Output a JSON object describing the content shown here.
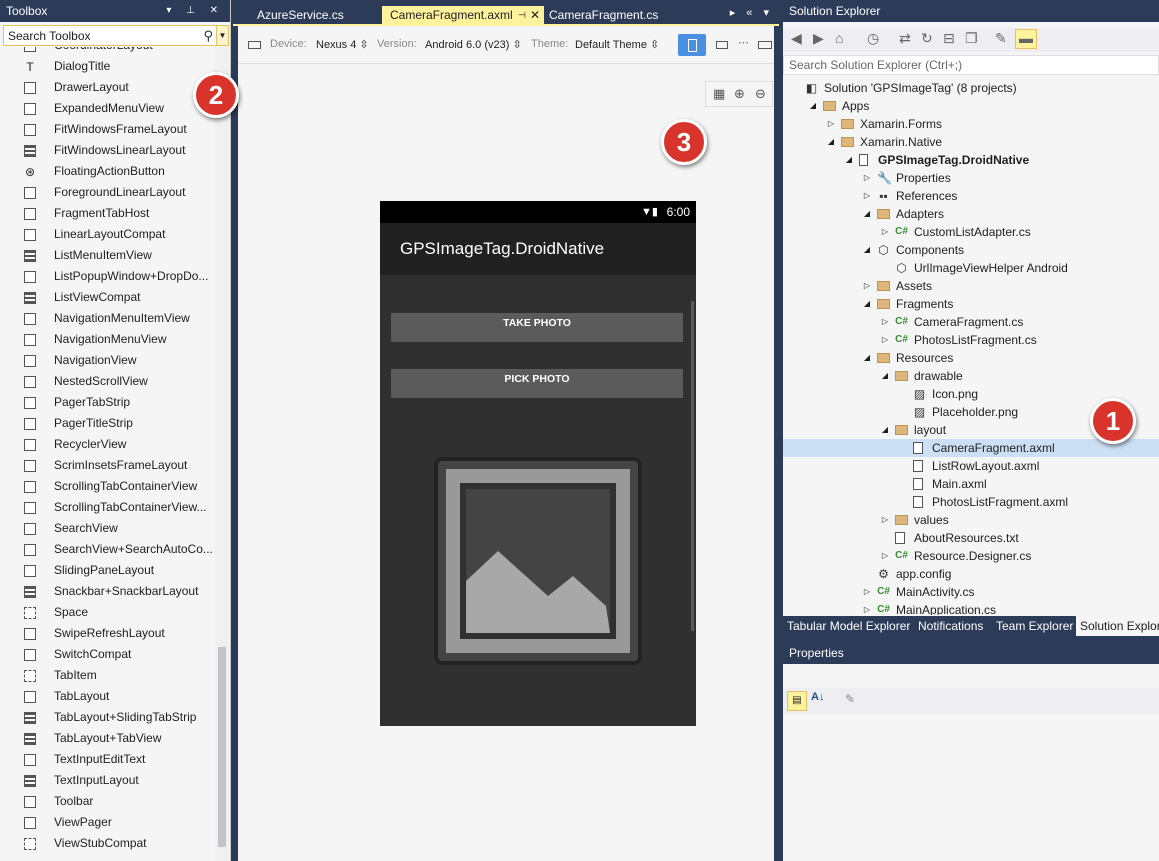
{
  "toolbox": {
    "title": "Toolbox",
    "search_value": "Search Toolbox",
    "items": [
      {
        "label": "CoordinatorLayout",
        "icon": "box-icon"
      },
      {
        "label": "DialogTitle",
        "icon": "text-icon"
      },
      {
        "label": "DrawerLayout",
        "icon": "box-icon"
      },
      {
        "label": "ExpandedMenuView",
        "icon": "box-icon"
      },
      {
        "label": "FitWindowsFrameLayout",
        "icon": "box-icon"
      },
      {
        "label": "FitWindowsLinearLayout",
        "icon": "list-icon"
      },
      {
        "label": "FloatingActionButton",
        "icon": "fab-icon"
      },
      {
        "label": "ForegroundLinearLayout",
        "icon": "box-icon"
      },
      {
        "label": "FragmentTabHost",
        "icon": "box-icon"
      },
      {
        "label": "LinearLayoutCompat",
        "icon": "box-icon"
      },
      {
        "label": "ListMenuItemView",
        "icon": "list-icon"
      },
      {
        "label": "ListPopupWindow+DropDo...",
        "icon": "box-icon"
      },
      {
        "label": "ListViewCompat",
        "icon": "list-icon"
      },
      {
        "label": "NavigationMenuItemView",
        "icon": "box-icon"
      },
      {
        "label": "NavigationMenuView",
        "icon": "box-icon"
      },
      {
        "label": "NavigationView",
        "icon": "box-icon"
      },
      {
        "label": "NestedScrollView",
        "icon": "box-icon"
      },
      {
        "label": "PagerTabStrip",
        "icon": "box-icon"
      },
      {
        "label": "PagerTitleStrip",
        "icon": "box-icon"
      },
      {
        "label": "RecyclerView",
        "icon": "box-icon"
      },
      {
        "label": "ScrimInsetsFrameLayout",
        "icon": "box-icon"
      },
      {
        "label": "ScrollingTabContainerView",
        "icon": "box-icon"
      },
      {
        "label": "ScrollingTabContainerView...",
        "icon": "box-icon"
      },
      {
        "label": "SearchView",
        "icon": "box-icon"
      },
      {
        "label": "SearchView+SearchAutoCo...",
        "icon": "box-icon"
      },
      {
        "label": "SlidingPaneLayout",
        "icon": "box-icon"
      },
      {
        "label": "Snackbar+SnackbarLayout",
        "icon": "list-icon"
      },
      {
        "label": "Space",
        "icon": "dashed-icon"
      },
      {
        "label": "SwipeRefreshLayout",
        "icon": "box-icon"
      },
      {
        "label": "SwitchCompat",
        "icon": "box-icon"
      },
      {
        "label": "TabItem",
        "icon": "dashed-icon"
      },
      {
        "label": "TabLayout",
        "icon": "box-icon"
      },
      {
        "label": "TabLayout+SlidingTabStrip",
        "icon": "list-icon"
      },
      {
        "label": "TabLayout+TabView",
        "icon": "list-icon"
      },
      {
        "label": "TextInputEditText",
        "icon": "box-icon"
      },
      {
        "label": "TextInputLayout",
        "icon": "list-icon"
      },
      {
        "label": "Toolbar",
        "icon": "box-icon"
      },
      {
        "label": "ViewPager",
        "icon": "box-icon"
      },
      {
        "label": "ViewStubCompat",
        "icon": "dashed-icon"
      }
    ]
  },
  "editor": {
    "tabs": [
      {
        "label": "AzureService.cs",
        "active": false
      },
      {
        "label": "CameraFragment.axml",
        "active": true
      },
      {
        "label": "CameraFragment.cs",
        "active": false
      }
    ],
    "toolbar": {
      "device_label": "Device:",
      "device_value": "Nexus 4",
      "version_label": "Version:",
      "version_value": "Android 6.0 (v23)",
      "theme_label": "Theme:",
      "theme_value": "Default Theme"
    },
    "phone": {
      "time": "6:00",
      "app_title": "GPSImageTag.DroidNative",
      "take_photo": "TAKE PHOTO",
      "pick_photo": "PICK PHOTO"
    }
  },
  "solution_explorer": {
    "title": "Solution Explorer",
    "search_placeholder": "Search Solution Explorer (Ctrl+;)",
    "tree": [
      {
        "label": "Solution 'GPSImageTag' (8 projects)",
        "depth": 0,
        "arrow": "",
        "icon": "solution-icon"
      },
      {
        "label": "Apps",
        "depth": 1,
        "arrow": "open",
        "icon": "folder-icon"
      },
      {
        "label": "Xamarin.Forms",
        "depth": 2,
        "arrow": "closed",
        "icon": "folder-icon"
      },
      {
        "label": "Xamarin.Native",
        "depth": 2,
        "arrow": "open",
        "icon": "folder-icon"
      },
      {
        "label": "GPSImageTag.DroidNative",
        "depth": 3,
        "arrow": "open",
        "icon": "android-project-icon",
        "bold": true
      },
      {
        "label": "Properties",
        "depth": 4,
        "arrow": "closed",
        "icon": "wrench-icon"
      },
      {
        "label": "References",
        "depth": 4,
        "arrow": "closed",
        "icon": "references-icon"
      },
      {
        "label": "Adapters",
        "depth": 4,
        "arrow": "open",
        "icon": "folder-icon"
      },
      {
        "label": "CustomListAdapter.cs",
        "depth": 5,
        "arrow": "closed",
        "icon": "csharp-icon"
      },
      {
        "label": "Components",
        "depth": 4,
        "arrow": "open",
        "icon": "component-icon"
      },
      {
        "label": "UrlImageViewHelper Android",
        "depth": 5,
        "arrow": "",
        "icon": "component-icon"
      },
      {
        "label": "Assets",
        "depth": 4,
        "arrow": "closed",
        "icon": "folder-icon"
      },
      {
        "label": "Fragments",
        "depth": 4,
        "arrow": "open",
        "icon": "folder-icon"
      },
      {
        "label": "CameraFragment.cs",
        "depth": 5,
        "arrow": "closed",
        "icon": "csharp-icon"
      },
      {
        "label": "PhotosListFragment.cs",
        "depth": 5,
        "arrow": "closed",
        "icon": "csharp-icon"
      },
      {
        "label": "Resources",
        "depth": 4,
        "arrow": "open",
        "icon": "folder-icon"
      },
      {
        "label": "drawable",
        "depth": 5,
        "arrow": "open",
        "icon": "folder-icon"
      },
      {
        "label": "Icon.png",
        "depth": 6,
        "arrow": "",
        "icon": "image-file-icon"
      },
      {
        "label": "Placeholder.png",
        "depth": 6,
        "arrow": "",
        "icon": "image-file-icon"
      },
      {
        "label": "layout",
        "depth": 5,
        "arrow": "open",
        "icon": "folder-icon"
      },
      {
        "label": "CameraFragment.axml",
        "depth": 6,
        "arrow": "",
        "icon": "file-icon",
        "selected": true
      },
      {
        "label": "ListRowLayout.axml",
        "depth": 6,
        "arrow": "",
        "icon": "file-icon"
      },
      {
        "label": "Main.axml",
        "depth": 6,
        "arrow": "",
        "icon": "file-icon"
      },
      {
        "label": "PhotosListFragment.axml",
        "depth": 6,
        "arrow": "",
        "icon": "file-icon"
      },
      {
        "label": "values",
        "depth": 5,
        "arrow": "closed",
        "icon": "folder-icon"
      },
      {
        "label": "AboutResources.txt",
        "depth": 5,
        "arrow": "",
        "icon": "file-icon"
      },
      {
        "label": "Resource.Designer.cs",
        "depth": 5,
        "arrow": "closed",
        "icon": "csharp-icon"
      },
      {
        "label": "app.config",
        "depth": 4,
        "arrow": "",
        "icon": "config-icon"
      },
      {
        "label": "MainActivity.cs",
        "depth": 4,
        "arrow": "closed",
        "icon": "csharp-icon"
      },
      {
        "label": "MainApplication.cs",
        "depth": 4,
        "arrow": "closed",
        "icon": "csharp-icon"
      }
    ],
    "bottom_tabs": [
      {
        "label": "Tabular Model Explorer",
        "active": false
      },
      {
        "label": "Notifications",
        "active": false
      },
      {
        "label": "Team Explorer",
        "active": false
      },
      {
        "label": "Solution Explorer",
        "active": true
      }
    ]
  },
  "properties": {
    "title": "Properties"
  },
  "callouts": [
    "1",
    "2",
    "3"
  ]
}
